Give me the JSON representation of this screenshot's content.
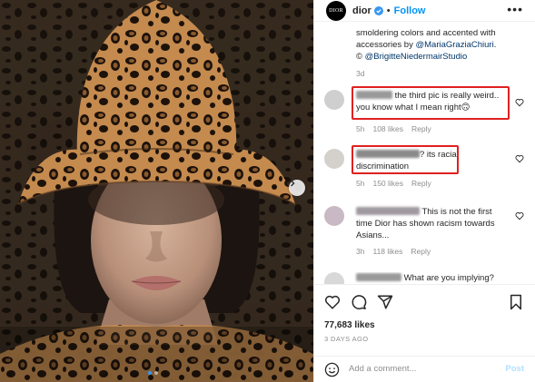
{
  "post": {
    "username": "dior",
    "avatar_text": "DIOR",
    "separator": "•",
    "follow_label": "Follow",
    "more_label": "•••",
    "caption_lines": [
      "smoldering colors and accented with",
      "accessories by ",
      "@MariaGraziaChiuri",
      ".",
      "© ",
      "@BrigitteNiedermairStudio"
    ],
    "caption_age": "3d",
    "likes": "77,683 likes",
    "date": "3 DAYS AGO"
  },
  "comments": [
    {
      "text_line1": " the third pic is really weird..",
      "text_line2": "you know what I mean right",
      "emoji": "🙃",
      "time": "5h",
      "likes": "108 likes",
      "reply": "Reply",
      "highlighted": true
    },
    {
      "text_line1": "? its racial",
      "text_line2": "discrimination",
      "time": "5h",
      "likes": "150 likes",
      "reply": "Reply",
      "highlighted": true
    },
    {
      "text_line1": " This is not the first",
      "text_line2": "time Dior has shown racism towards",
      "text_line3": "Asians...",
      "time": "3h",
      "likes": "118 likes",
      "reply": "Reply",
      "highlighted": false
    },
    {
      "text_line1": " What are you implying?",
      "highlighted": false
    }
  ],
  "composer": {
    "placeholder": "Add a comment...",
    "post_label": "Post"
  },
  "colors": {
    "accent": "#0095f6",
    "highlight_box": "#e02020",
    "secondary_text": "#8e8e8e",
    "post_disabled": "#b2dffc"
  },
  "icons": {
    "verified": "verified-badge-icon",
    "like": "heart-icon",
    "comment": "comment-bubble-icon",
    "share": "paper-plane-icon",
    "save": "bookmark-icon",
    "emoji": "smiley-icon",
    "next": "chevron-right-icon"
  },
  "carousel": {
    "current": 1,
    "total": 2
  }
}
